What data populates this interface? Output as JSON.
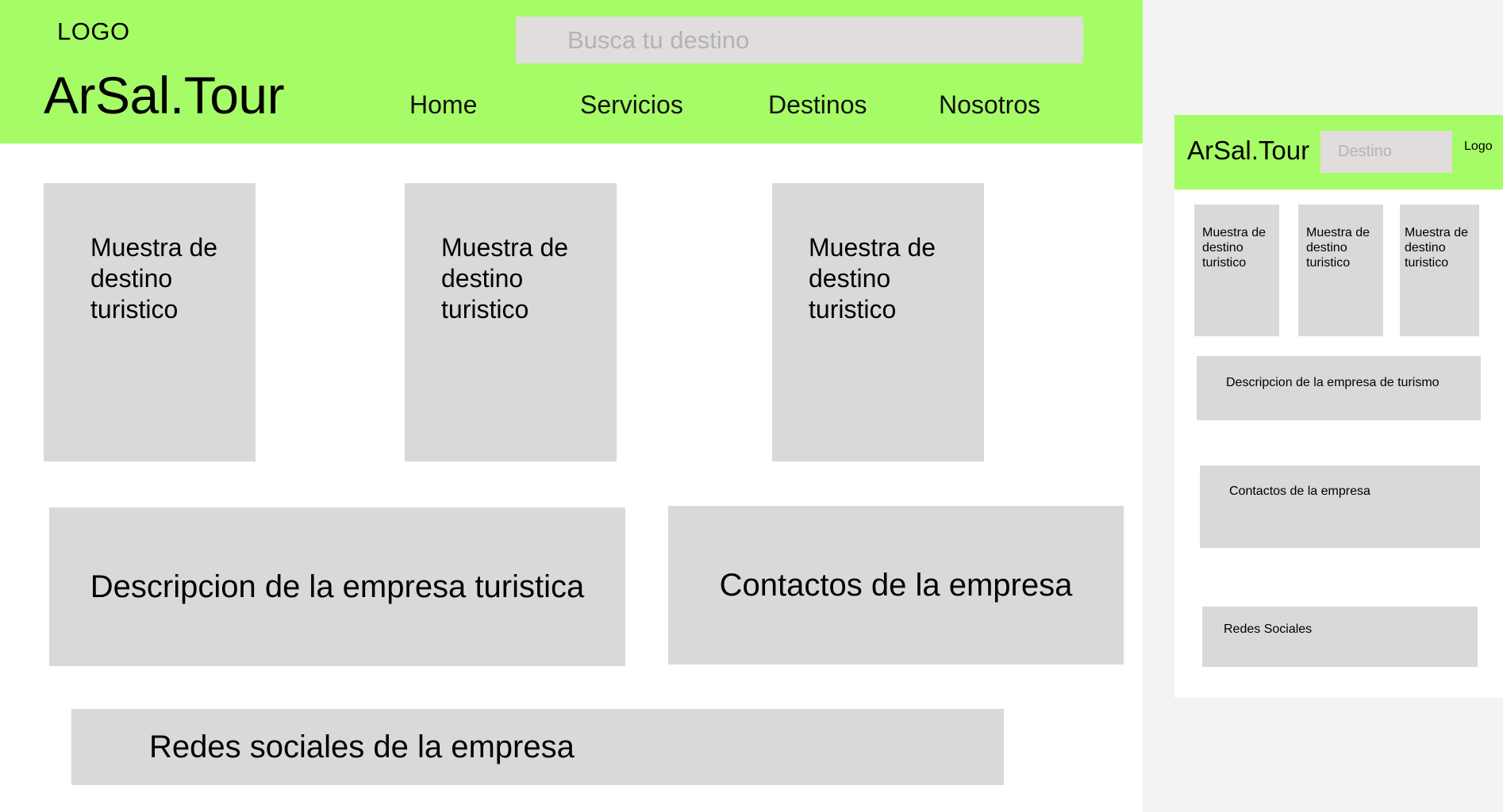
{
  "desktop": {
    "header": {
      "logo_text": "LOGO",
      "brand": "ArSal.Tour",
      "search_placeholder": "Busca tu destino",
      "nav": [
        "Home",
        "Servicios",
        "Destinos",
        "Nosotros"
      ]
    },
    "cards": [
      "Muestra de destino turistico",
      "Muestra de destino turistico",
      "Muestra de destino turistico"
    ],
    "description": "Descripcion de la empresa turistica",
    "contacts": "Contactos de la empresa",
    "social": "Redes sociales de la empresa"
  },
  "mobile": {
    "header": {
      "brand": "ArSal.Tour",
      "search_placeholder": "Destino",
      "logo_text": "Logo"
    },
    "cards": [
      "Muestra de destino turistico",
      "Muestra de destino turistico",
      "Muestra de destino turistico"
    ],
    "description": "Descripcion de la empresa de turismo",
    "contacts": "Contactos de la empresa",
    "social": "Redes Sociales"
  },
  "colors": {
    "header_green": "#a6fc66",
    "placeholder_gray": "#d9d9d9",
    "search_bg": "#e0dddc",
    "canvas": "#f3f3f3"
  }
}
